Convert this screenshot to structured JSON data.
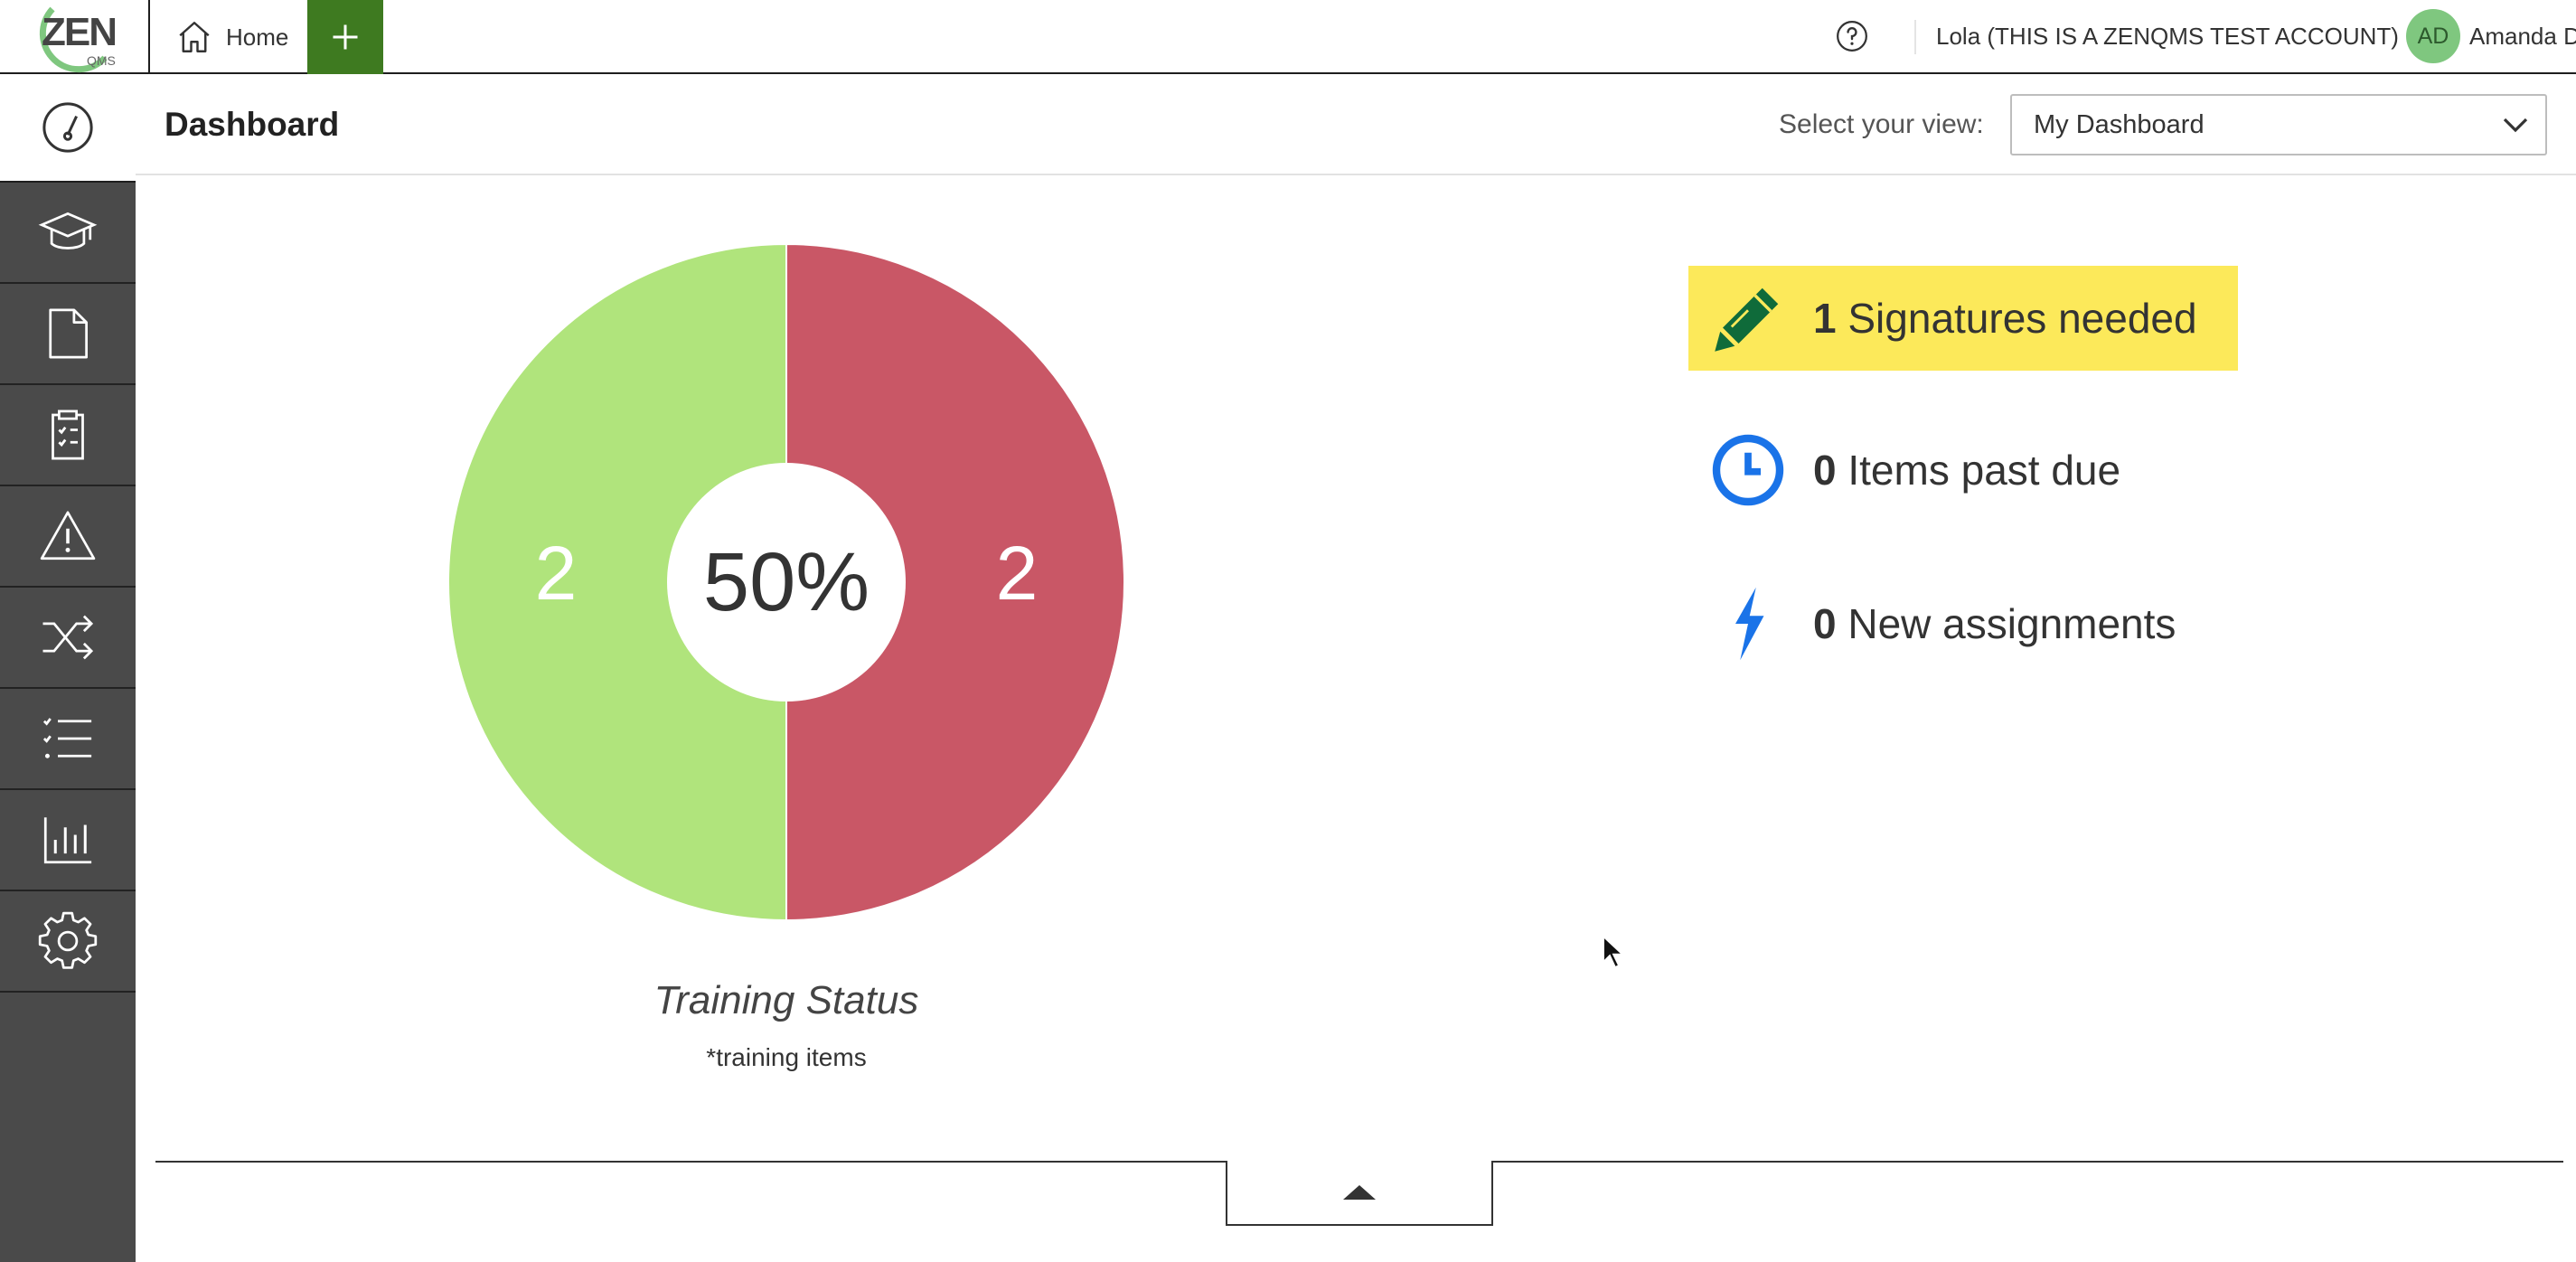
{
  "brand": {
    "logo_text": "ZEN",
    "logo_sub": "QMS"
  },
  "topbar": {
    "home_label": "Home",
    "account_label": "Lola (THIS IS A ZENQMS TEST ACCOUNT)",
    "avatar_initials": "AD",
    "user_name": "Amanda D"
  },
  "sidebar": {
    "items": [
      "dashboard-icon",
      "training-icon",
      "document-icon",
      "clipboard-icon",
      "warning-icon",
      "shuffle-icon",
      "checklist-icon",
      "bar-chart-icon",
      "gear-icon"
    ]
  },
  "header": {
    "title": "Dashboard",
    "view_label": "Select your view:",
    "view_value": "My Dashboard"
  },
  "chart_data": {
    "type": "pie",
    "title": "Training Status",
    "subtitle": "*training items",
    "center_label": "50%",
    "slices": [
      {
        "value": 2,
        "color": "#b0e47c"
      },
      {
        "value": 2,
        "color": "#c95766"
      }
    ]
  },
  "status": {
    "signatures": {
      "count": "1",
      "label": "Signatures needed"
    },
    "past_due": {
      "count": "0",
      "label": "Items past due"
    },
    "assignments": {
      "count": "0",
      "label": "New assignments"
    }
  },
  "colors": {
    "accent_green": "#3e7a20",
    "sidebar_bg": "#4a4a4a",
    "highlight_yellow": "#fce95a",
    "icon_blue": "#1a73e8",
    "pencil_green": "#0f6b3a"
  }
}
